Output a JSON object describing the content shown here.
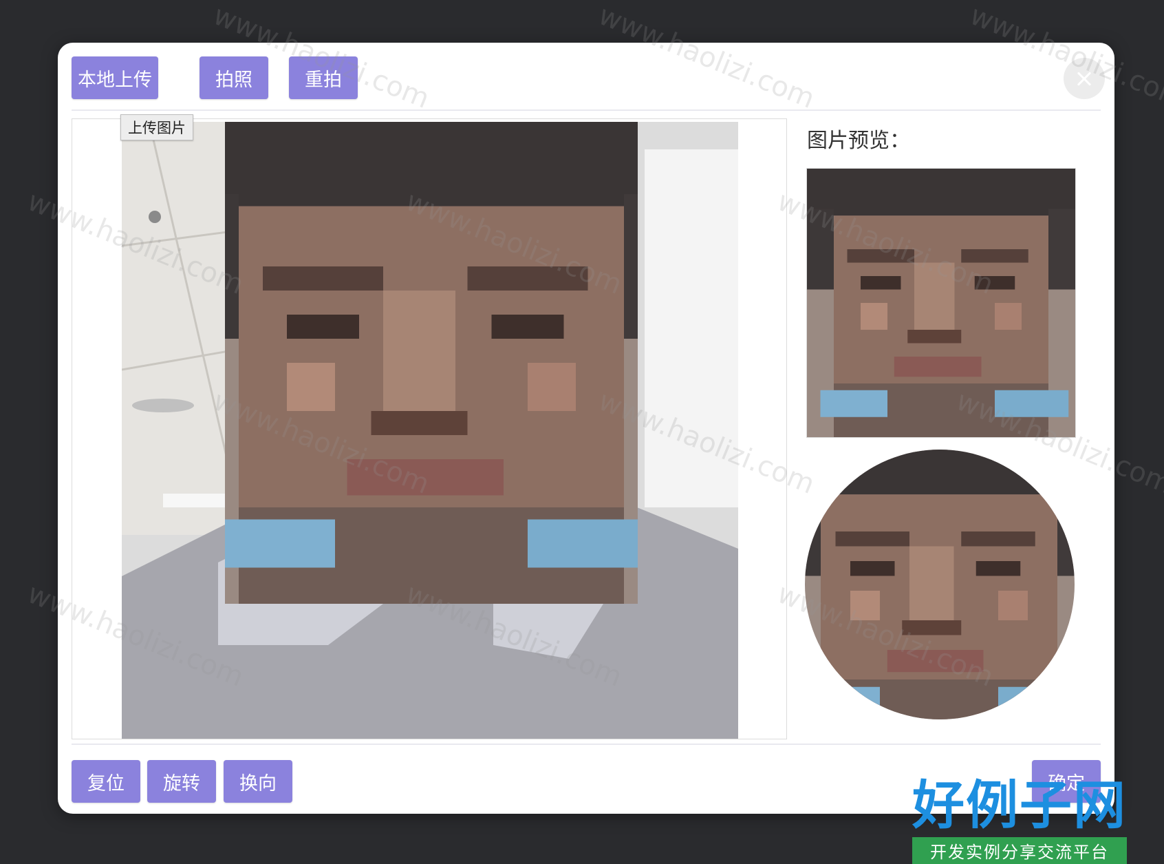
{
  "toolbar": {
    "upload_local": "本地上传",
    "take_photo": "拍照",
    "retake": "重拍",
    "tooltip": "上传图片"
  },
  "preview": {
    "title": "图片预览："
  },
  "bottom": {
    "reset": "复位",
    "rotate": "旋转",
    "flip": "换向",
    "confirm": "确定"
  },
  "watermark": {
    "text": "www.haolizi.com"
  },
  "logo": {
    "title": "好例子网",
    "subtitle": "开发实例分享交流平台"
  },
  "colors": {
    "button": "#8b82dd",
    "background": "#2a2b2e",
    "dialog": "#ffffff"
  }
}
